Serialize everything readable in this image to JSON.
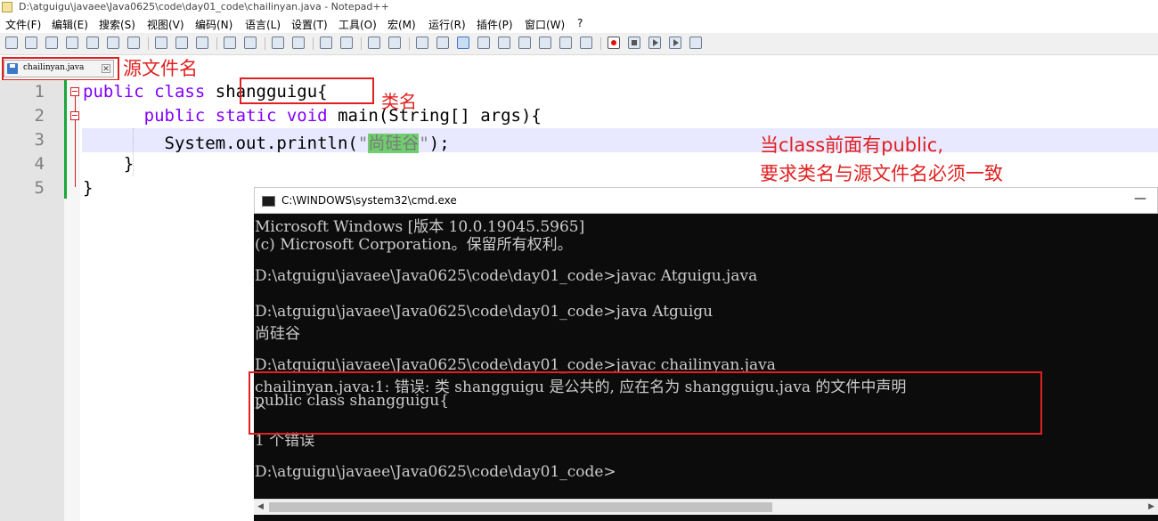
{
  "window": {
    "title": "D:\\atguigu\\javaee\\Java0625\\code\\day01_code\\chailinyan.java - Notepad++"
  },
  "menu": [
    "文件(F)",
    "编辑(E)",
    "搜索(S)",
    "视图(V)",
    "编码(N)",
    "语言(L)",
    "设置(T)",
    "工具(O)",
    "宏(M)",
    "运行(R)",
    "插件(P)",
    "窗口(W)",
    "?"
  ],
  "tab": {
    "label": "chailinyan.java",
    "close": "✕"
  },
  "editor": {
    "line_numbers": [
      "1",
      "2",
      "3",
      "4",
      "5"
    ],
    "lines": {
      "l1_kw1": "public",
      "l1_kw2": "class",
      "l1_name": "shangguigu",
      "l1_brace": "{",
      "l2_indent": "    ",
      "l2_kw1": "public",
      "l2_kw2": "static",
      "l2_kw3": "void",
      "l2_rest": "main(String[] args){",
      "l3_pre": "        System.out.println(",
      "l3_q1": "\"",
      "l3_str": "尚硅谷",
      "l3_q2": "\"",
      "l3_post": ");",
      "l4": "    }",
      "l5": "}"
    }
  },
  "annotations": {
    "source_file_name": "源文件名",
    "class_name": "类名",
    "note_line1": "当class前面有public,",
    "note_line2": "要求类名与源文件名必须一致"
  },
  "cmd": {
    "title": "C:\\WINDOWS\\system32\\cmd.exe",
    "minimize": "—",
    "lines": [
      "Microsoft Windows [版本 10.0.19045.5965]",
      "(c) Microsoft Corporation。保留所有权利。",
      "",
      "D:\\atguigu\\javaee\\Java0625\\code\\day01_code>javac Atguigu.java",
      "",
      "D:\\atguigu\\javaee\\Java0625\\code\\day01_code>java Atguigu",
      "尚硅谷",
      "",
      "D:\\atguigu\\javaee\\Java0625\\code\\day01_code>javac chailinyan.java",
      "chailinyan.java:1: 错误: 类 shangguigu 是公共的, 应在名为 shangguigu.java 的文件中声明",
      "public class shangguigu{",
      "       ^",
      "1 个错误",
      "",
      "D:\\atguigu\\javaee\\Java0625\\code\\day01_code>"
    ]
  }
}
